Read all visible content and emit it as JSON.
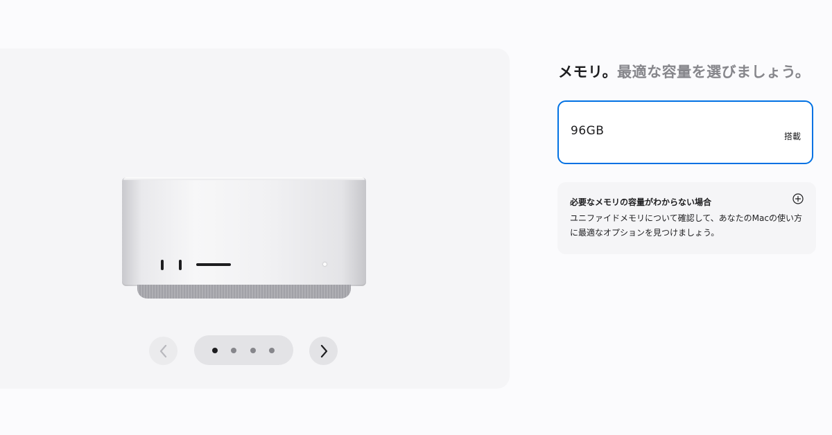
{
  "gallery": {
    "prev_label": "前へ",
    "next_label": "次へ",
    "slides_total": 4,
    "active_slide": 1
  },
  "section": {
    "title_strong": "メモリ。",
    "title_muted": "最適な容量を選びましょう。"
  },
  "memory_option": {
    "value": "96GB",
    "status": "搭載",
    "selected": true
  },
  "help": {
    "title": "必要なメモリの容量がわからない場合",
    "body": "ユニファイドメモリについて確認して、あなたのMacの使い方に最適なオプションを見つけましょう。"
  },
  "colors": {
    "accent": "#0071e3",
    "text": "#1d1d1f",
    "muted_text": "#86868b",
    "panel": "#f5f5f7"
  },
  "icons": {
    "prev": "chevron-left-icon",
    "next": "chevron-right-icon",
    "expand": "plus-circle-icon"
  }
}
